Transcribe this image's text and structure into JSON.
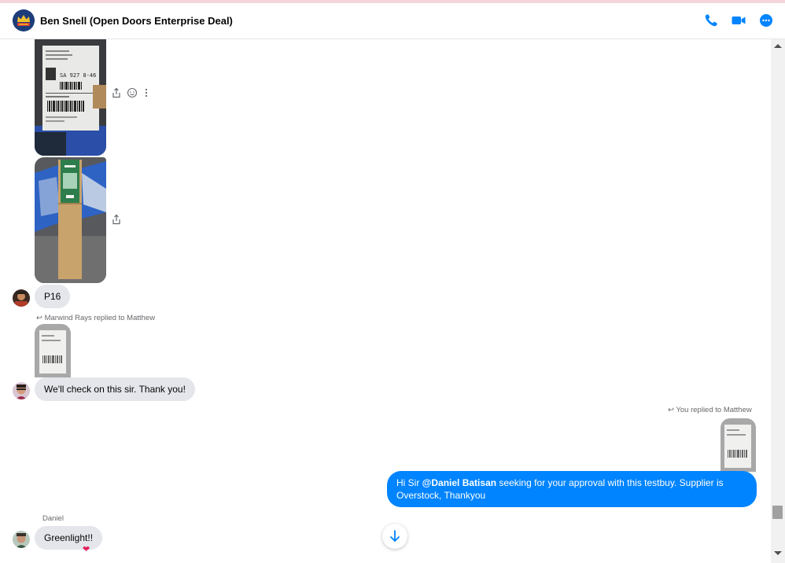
{
  "header": {
    "title": "Ben Snell (Open Doors Enterprise Deal)",
    "icons": [
      "phone-icon",
      "video-icon",
      "more-icon"
    ],
    "accent": "#0084ff"
  },
  "messages": {
    "p16_text": "P16",
    "reply1_note": "Marwind Rays replied to Matthew",
    "reply1_text": "We'll check on this sir. Thank you!",
    "reply2_note": "You replied to Matthew",
    "out_prefix": "Hi Sir ",
    "out_mention": "@Daniel Batisan",
    "out_rest": " seeking for your approval with this testbuy. Supplier is Overstock, Thankyou",
    "daniel_sender": "Daniel",
    "daniel_text": "Greenlight!!",
    "daniel_reaction": "❤"
  }
}
